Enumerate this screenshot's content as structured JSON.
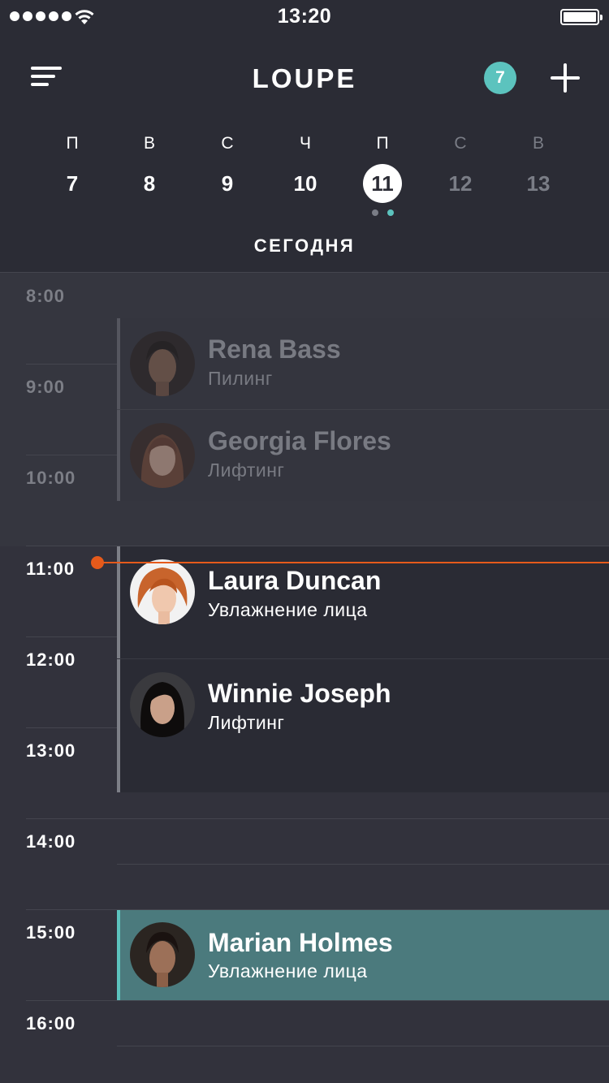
{
  "status_bar": {
    "time": "13:20"
  },
  "header": {
    "title": "LOUPE",
    "notification_count": "7",
    "menu_icon": "menu-lines-icon",
    "add_icon": "plus-icon"
  },
  "week": {
    "days": [
      {
        "letter": "П",
        "number": "7"
      },
      {
        "letter": "В",
        "number": "8"
      },
      {
        "letter": "С",
        "number": "9"
      },
      {
        "letter": "Ч",
        "number": "10"
      },
      {
        "letter": "П",
        "number": "11"
      },
      {
        "letter": "С",
        "number": "12"
      },
      {
        "letter": "В",
        "number": "13"
      }
    ],
    "selected_index": 4,
    "today_label": "СЕГОДНЯ"
  },
  "schedule": {
    "hours": [
      "8:00",
      "9:00",
      "10:00",
      "11:00",
      "12:00",
      "13:00",
      "14:00",
      "15:00",
      "16:00"
    ],
    "appointments": [
      {
        "name": "Rena Bass",
        "service": "Пилинг"
      },
      {
        "name": "Georgia Flores",
        "service": "Лифтинг"
      },
      {
        "name": "Laura Duncan",
        "service": "Увлажнение лица"
      },
      {
        "name": "Winnie Joseph",
        "service": "Лифтинг"
      },
      {
        "name": "Marian Holmes",
        "service": "Увлажнение лица"
      }
    ]
  },
  "colors": {
    "header_bg": "#2b2c35",
    "schedule_bg": "#32323c",
    "accent_teal": "#5cc3be",
    "highlight_event": "#4b7a7d",
    "now_indicator": "#e55a1b"
  }
}
